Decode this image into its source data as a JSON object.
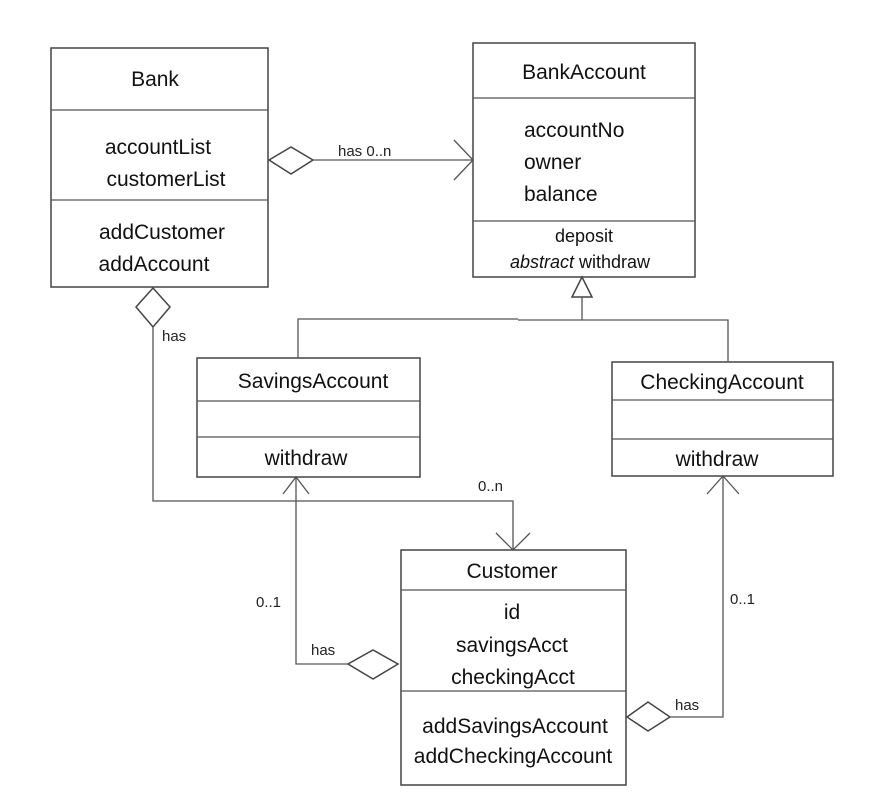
{
  "classes": {
    "bank": {
      "name": "Bank",
      "attributes": [
        "accountList",
        "customerList"
      ],
      "methods": [
        "addCustomer",
        "addAccount"
      ]
    },
    "bank_account": {
      "name": "BankAccount",
      "attributes": [
        "accountNo",
        "owner",
        "balance"
      ],
      "methods": [
        "deposit",
        "withdraw"
      ],
      "method_modifier": "abstract"
    },
    "savings_account": {
      "name": "SavingsAccount",
      "methods": [
        "withdraw"
      ]
    },
    "checking_account": {
      "name": "CheckingAccount",
      "methods": [
        "withdraw"
      ]
    },
    "customer": {
      "name": "Customer",
      "attributes": [
        "id",
        "savingsAcct",
        "checkingAcct"
      ],
      "methods": [
        "addSavingsAccount",
        "addCheckingAccount"
      ]
    }
  },
  "relations": {
    "bank_accounts": {
      "type": "aggregation",
      "label": "has 0..n"
    },
    "bank_customers": {
      "type": "aggregation",
      "label": "has",
      "multiplicity": "0..n"
    },
    "inheritance": {
      "type": "generalization"
    },
    "customer_savings": {
      "type": "aggregation",
      "label": "has",
      "multiplicity": "0..1"
    },
    "customer_checking": {
      "type": "aggregation",
      "label": "has",
      "multiplicity": "0..1"
    }
  }
}
